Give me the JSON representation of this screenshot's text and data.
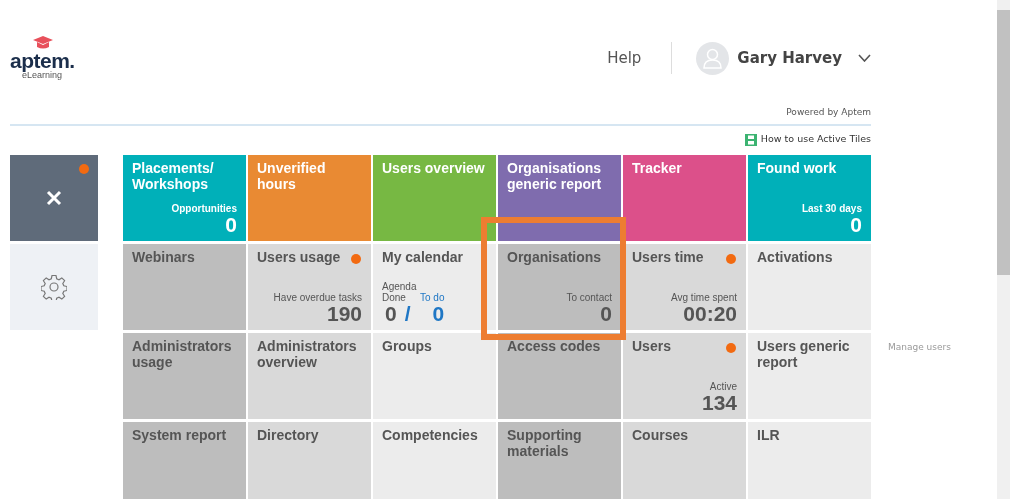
{
  "header": {
    "logo": {
      "name": "aptem.",
      "tagline": "eLearning"
    },
    "help": "Help",
    "user": {
      "name": "Gary Harvey"
    }
  },
  "powered_by": "Powered by Aptem",
  "help_link": "How to use Active Tiles",
  "sidebar": {
    "notification": true
  },
  "tiles": [
    {
      "title": "Placements/ Workshops",
      "color": "#00b0b9",
      "inverse": true,
      "kind": "stat",
      "label": "Opportunities",
      "value": "0",
      "dot": false,
      "highlighted": false
    },
    {
      "title": "Unverified hours",
      "color": "#e98a33",
      "inverse": true,
      "kind": "plain",
      "dot": false,
      "highlighted": false
    },
    {
      "title": "Users overview",
      "color": "#77b843",
      "inverse": true,
      "kind": "plain",
      "dot": false,
      "highlighted": false
    },
    {
      "title": "Organisations generic report",
      "color": "#7f6cae",
      "inverse": true,
      "kind": "plain",
      "dot": false,
      "highlighted": false
    },
    {
      "title": "Tracker",
      "color": "#dc508a",
      "inverse": true,
      "kind": "plain",
      "dot": false,
      "highlighted": false
    },
    {
      "title": "Found work",
      "color": "#00b0b9",
      "inverse": true,
      "kind": "stat",
      "label": "Last 30 days",
      "value": "0",
      "dot": false,
      "highlighted": false
    },
    {
      "title": "Webinars",
      "color": "#bdbdbd",
      "inverse": false,
      "kind": "plain",
      "dot": false,
      "highlighted": false
    },
    {
      "title": "Users usage",
      "color": "#d9d9d9",
      "inverse": false,
      "kind": "stat",
      "label": "Have overdue tasks",
      "value": "190",
      "dot": true,
      "highlighted": false
    },
    {
      "title": "My calendar",
      "color": "#ececec",
      "inverse": false,
      "kind": "calendar",
      "agenda": "Agenda",
      "done_label": "Done",
      "todo_label": "To do",
      "done": "0",
      "separator": "/",
      "todo": "0",
      "dot": false,
      "highlighted": false
    },
    {
      "title": "Organisations",
      "color": "#bdbdbd",
      "inverse": false,
      "kind": "stat",
      "label": "To contact",
      "value": "0",
      "dot": false,
      "highlighted": true
    },
    {
      "title": "Users time",
      "color": "#d9d9d9",
      "inverse": false,
      "kind": "stat",
      "label": "Avg time spent",
      "value": "00:20",
      "dot": true,
      "highlighted": false
    },
    {
      "title": "Activations",
      "color": "#ececec",
      "inverse": false,
      "kind": "plain",
      "dot": false,
      "highlighted": false
    },
    {
      "title": "Administrators usage",
      "color": "#bdbdbd",
      "inverse": false,
      "kind": "plain",
      "dot": false,
      "highlighted": false
    },
    {
      "title": "Administrators overview",
      "color": "#d9d9d9",
      "inverse": false,
      "kind": "plain",
      "dot": false,
      "highlighted": false
    },
    {
      "title": "Groups",
      "color": "#ececec",
      "inverse": false,
      "kind": "plain",
      "dot": false,
      "highlighted": false
    },
    {
      "title": "Access codes",
      "color": "#bdbdbd",
      "inverse": false,
      "kind": "plain",
      "dot": false,
      "highlighted": false
    },
    {
      "title": "Users",
      "color": "#d9d9d9",
      "inverse": false,
      "kind": "stat",
      "label": "Active",
      "value": "134",
      "dot": true,
      "highlighted": false
    },
    {
      "title": "Users generic report",
      "color": "#ececec",
      "inverse": false,
      "kind": "plain",
      "dot": false,
      "highlighted": false
    },
    {
      "title": "System report",
      "color": "#bdbdbd",
      "inverse": false,
      "kind": "plain",
      "dot": false,
      "highlighted": false
    },
    {
      "title": "Directory",
      "color": "#d9d9d9",
      "inverse": false,
      "kind": "plain",
      "dot": false,
      "highlighted": false
    },
    {
      "title": "Competencies",
      "color": "#ececec",
      "inverse": false,
      "kind": "plain",
      "dot": false,
      "highlighted": false
    },
    {
      "title": "Supporting materials",
      "color": "#bdbdbd",
      "inverse": false,
      "kind": "plain",
      "dot": false,
      "highlighted": false
    },
    {
      "title": "Courses",
      "color": "#d9d9d9",
      "inverse": false,
      "kind": "plain",
      "dot": false,
      "highlighted": false
    },
    {
      "title": "ILR",
      "color": "#ececec",
      "inverse": false,
      "kind": "plain",
      "dot": false,
      "highlighted": false
    }
  ],
  "background_items": [
    {
      "label": "Manage users"
    }
  ]
}
